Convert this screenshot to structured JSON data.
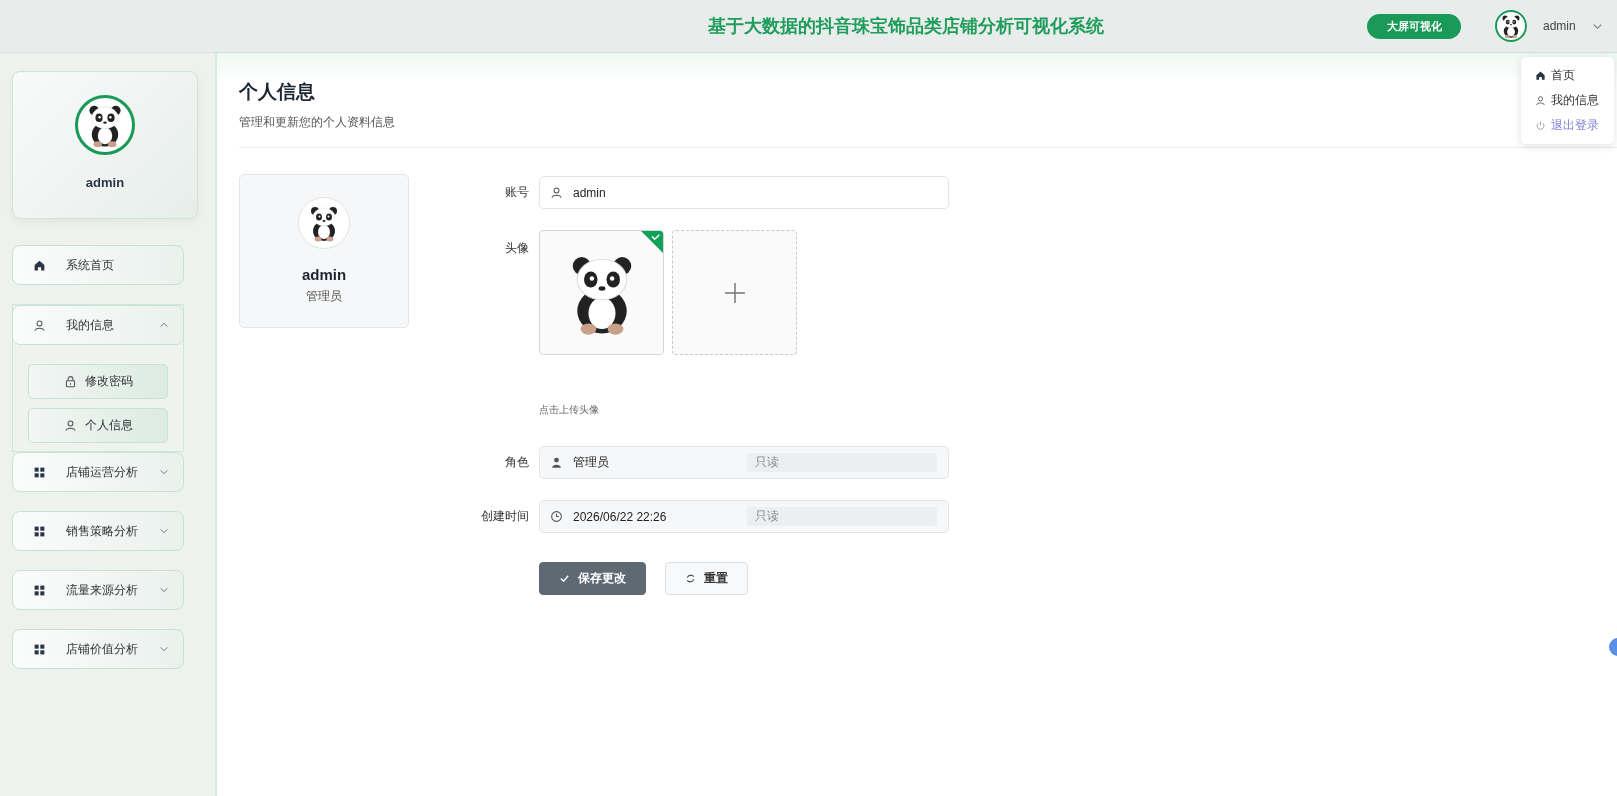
{
  "header": {
    "title": "基于大数据的抖音珠宝饰品类店铺分析可视化系统",
    "screen_button": "大屏可视化",
    "user": "admin"
  },
  "user_menu": {
    "items": [
      {
        "kind": "home",
        "label": "首页"
      },
      {
        "kind": "user",
        "label": "我的信息"
      },
      {
        "kind": "logout",
        "label": "退出登录"
      }
    ]
  },
  "sidebar": {
    "profile_name": "admin",
    "items": [
      {
        "kind": "home",
        "label": "系统首页"
      },
      {
        "kind": "user",
        "label": "我的信息",
        "expanded": true,
        "children": [
          {
            "kind": "lock",
            "label": "修改密码"
          },
          {
            "kind": "user",
            "label": "个人信息"
          }
        ]
      },
      {
        "kind": "grid",
        "label": "店铺运营分析",
        "expanded": false
      },
      {
        "kind": "grid",
        "label": "销售策略分析",
        "expanded": false
      },
      {
        "kind": "grid",
        "label": "流量来源分析",
        "expanded": false
      },
      {
        "kind": "grid",
        "label": "店铺价值分析",
        "expanded": false
      }
    ]
  },
  "page": {
    "title": "个人信息",
    "subtitle": "管理和更新您的个人资料信息"
  },
  "profile_card": {
    "name": "admin",
    "role": "管理员"
  },
  "form": {
    "fields": [
      {
        "kind": "text",
        "label": "账号",
        "value": "admin"
      },
      {
        "kind": "avatar",
        "label": "头像",
        "hint": "点击上传头像"
      },
      {
        "kind": "role",
        "label": "角色",
        "value": "管理员",
        "badge": "只读"
      },
      {
        "kind": "datetime",
        "label": "创建时间",
        "value": "2026/06/22 22:26",
        "badge": "只读"
      }
    ],
    "buttons": [
      {
        "kind": "primary",
        "label": "保存更改"
      },
      {
        "kind": "reset",
        "label": "重置"
      }
    ]
  }
}
